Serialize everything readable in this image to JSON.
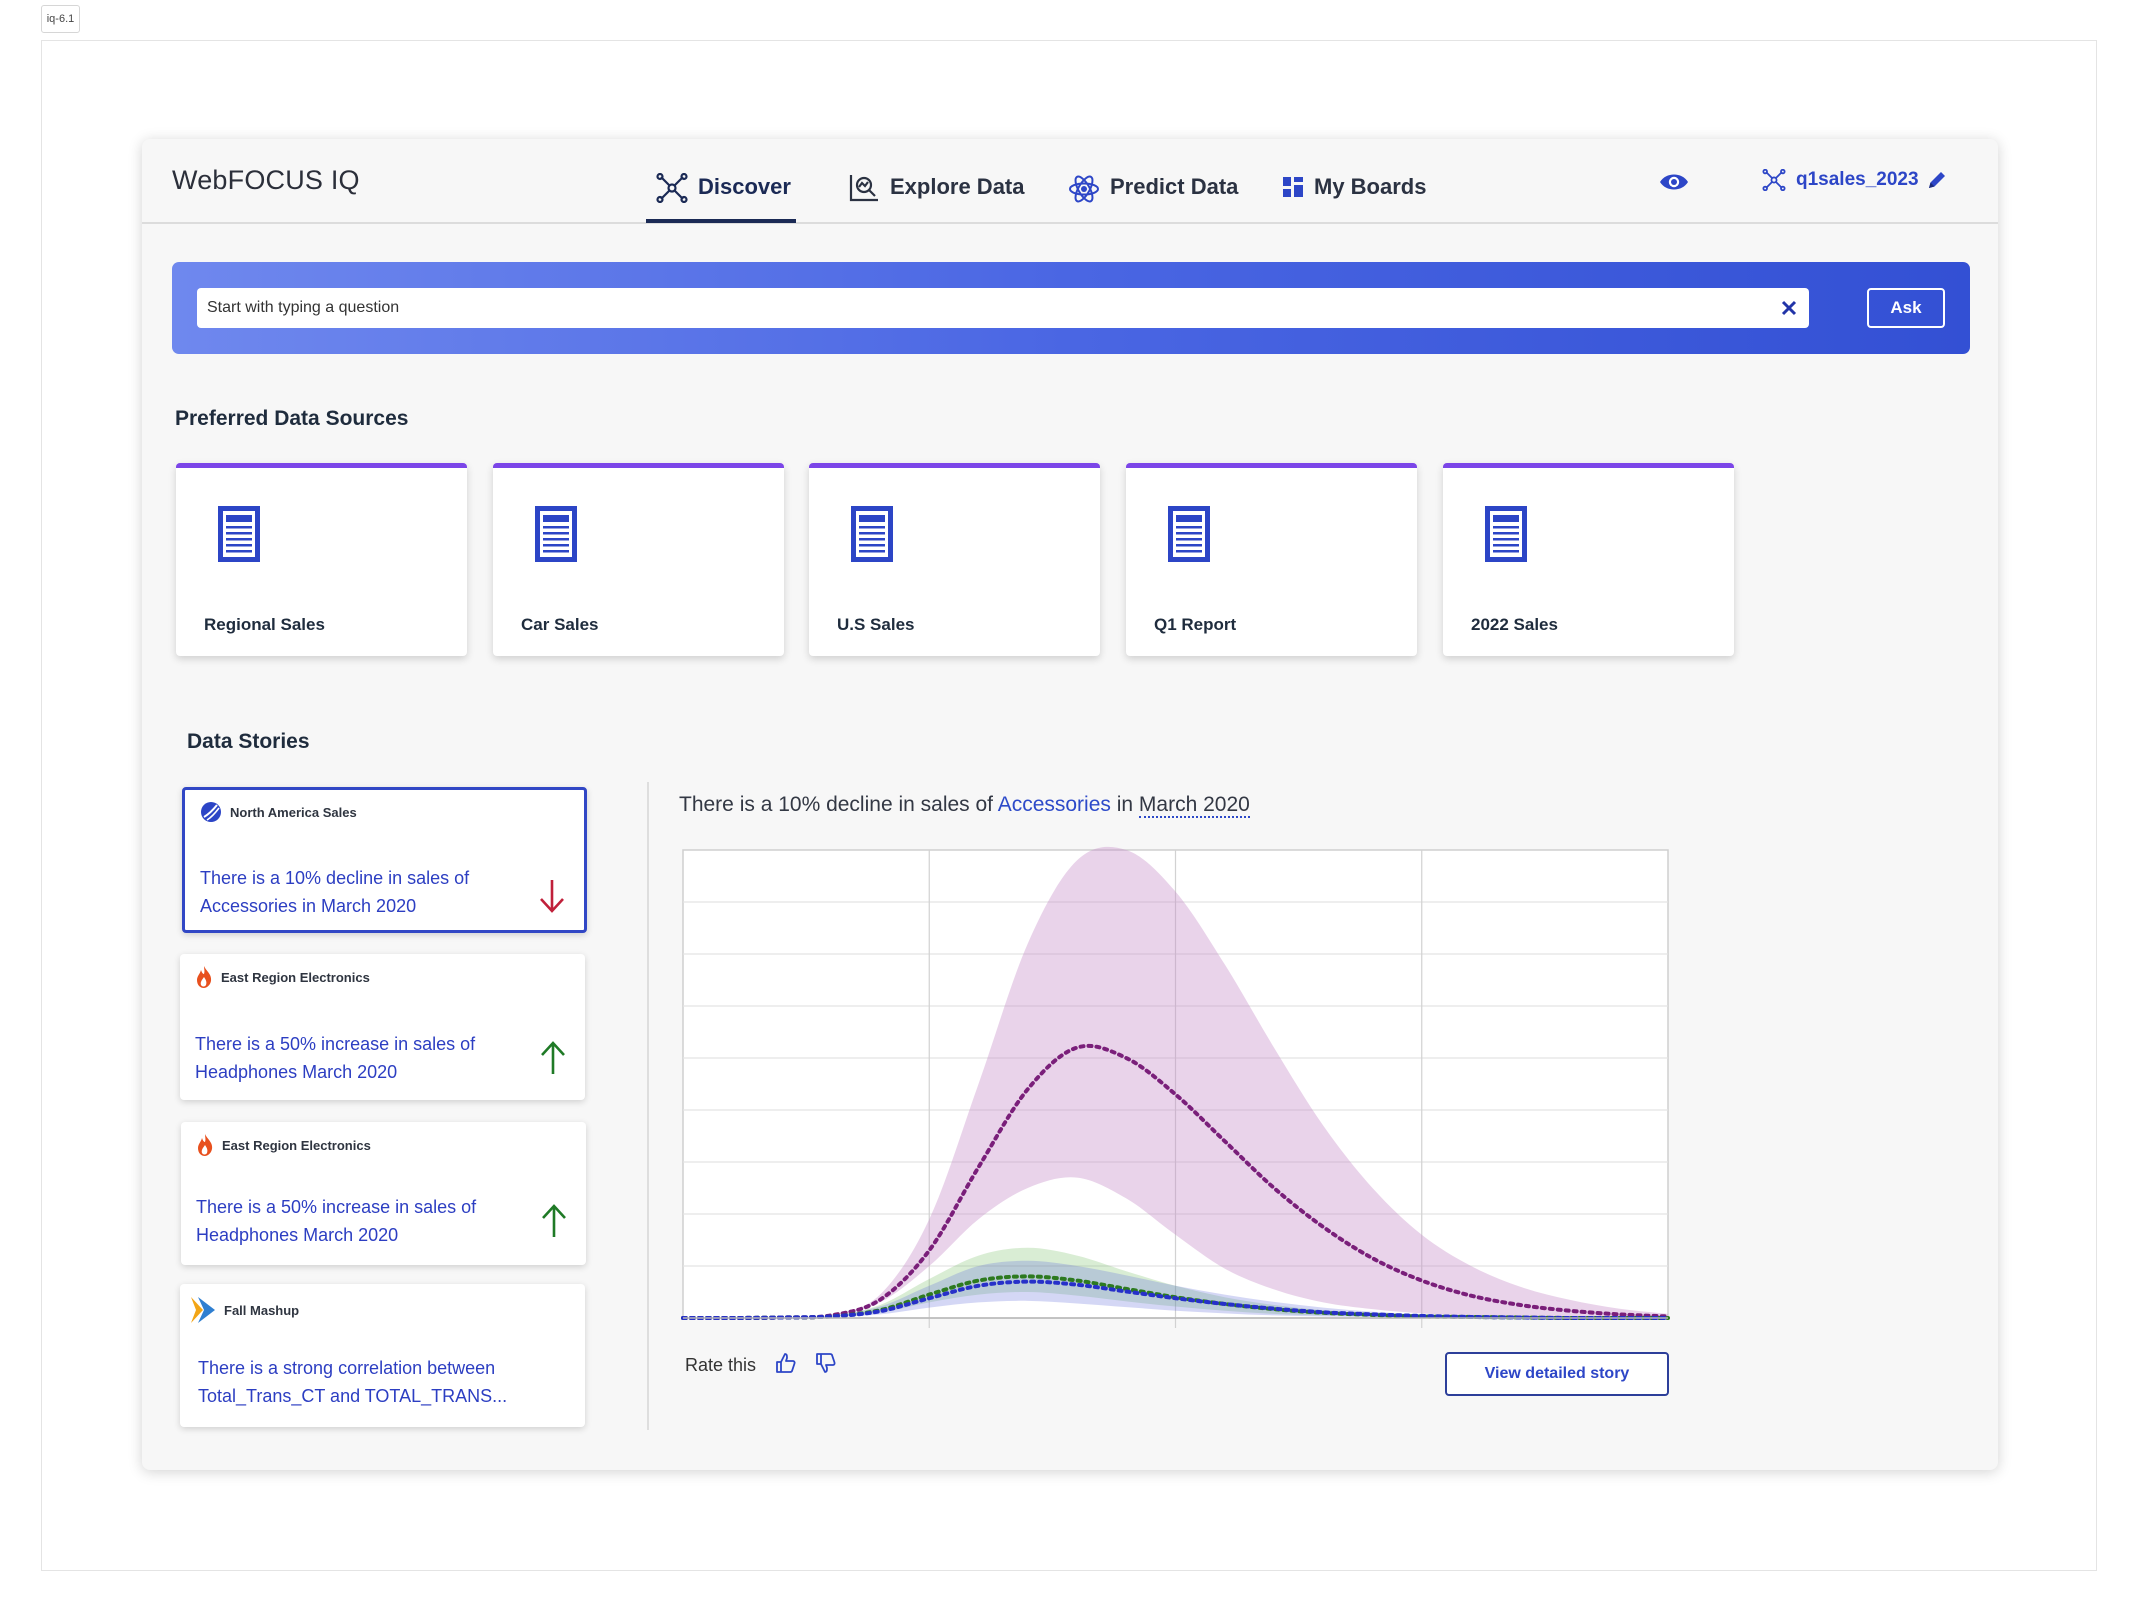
{
  "version_tag": "iq-6.1",
  "app": {
    "brand": "WebFOCUS IQ"
  },
  "nav": {
    "tabs": [
      {
        "label": "Discover",
        "icon": "network-icon",
        "active": true
      },
      {
        "label": "Explore Data",
        "icon": "chart-search-icon",
        "active": false
      },
      {
        "label": "Predict Data",
        "icon": "atom-icon",
        "active": false
      },
      {
        "label": "My Boards",
        "icon": "grid-icon",
        "active": false
      }
    ],
    "dataset": "q1sales_2023"
  },
  "search": {
    "placeholder": "Start with typing a question",
    "value": "",
    "ask_label": "Ask"
  },
  "sources": {
    "title": "Preferred Data Sources",
    "items": [
      "Regional Sales",
      "Car Sales",
      "U.S Sales",
      "Q1 Report",
      "2022 Sales"
    ]
  },
  "stories": {
    "title": "Data Stories",
    "items": [
      {
        "source": "North America Sales",
        "text": "There is a 10% decline in sales of Accessories in March 2020",
        "trend": "down",
        "selected": true
      },
      {
        "source": "East Region Electronics",
        "text": "There is a 50% increase in sales of Headphones March 2020",
        "trend": "up",
        "selected": false
      },
      {
        "source": "East Region Electronics",
        "text": "There is a 50% increase in sales of Headphones March 2020",
        "trend": "up",
        "selected": false
      },
      {
        "source": "Fall Mashup",
        "text": "There is a strong correlation between Total_Trans_CT and TOTAL_TRANS...",
        "trend": "none",
        "selected": false
      }
    ]
  },
  "detail": {
    "title_pre": "There is a 10% decline in sales of ",
    "title_accent": "Accessories",
    "title_mid": " in ",
    "title_post": "March 2020",
    "rate_label": "Rate this",
    "view_button": "View detailed story"
  },
  "colors": {
    "accent": "#2d46c7",
    "purple": "#7b45e8",
    "down": "#c0203a",
    "up": "#1f7a26"
  },
  "chart_data": {
    "type": "area",
    "title": "",
    "xlabel": "",
    "ylabel": "",
    "x": [
      0,
      0.5,
      1,
      1.5,
      2,
      2.5,
      3,
      3.5,
      4,
      4.5,
      5,
      5.5,
      6,
      6.5,
      7,
      7.5,
      8,
      8.5,
      9,
      9.5,
      10
    ],
    "xlim": [
      0,
      10
    ],
    "ylim": [
      0,
      9
    ],
    "grid": true,
    "series": [
      {
        "color": "#7a1f7a",
        "style": "dotted",
        "values": [
          0.0,
          0.0,
          0.01,
          0.05,
          0.35,
          1.3,
          2.9,
          4.4,
          5.2,
          5.0,
          4.3,
          3.4,
          2.5,
          1.75,
          1.15,
          0.72,
          0.43,
          0.25,
          0.14,
          0.07,
          0.03
        ],
        "band_low": [
          0.0,
          0.0,
          0.01,
          0.05,
          0.3,
          1.0,
          1.9,
          2.5,
          2.7,
          2.3,
          1.6,
          0.95,
          0.55,
          0.3,
          0.17,
          0.09,
          0.05,
          0.03,
          0.02,
          0.01,
          0.0
        ],
        "band_high": [
          0.0,
          0.0,
          0.01,
          0.06,
          0.45,
          1.9,
          4.5,
          7.2,
          8.8,
          9.0,
          8.2,
          6.8,
          5.2,
          3.7,
          2.5,
          1.6,
          1.0,
          0.6,
          0.35,
          0.18,
          0.08
        ]
      },
      {
        "color": "#2d7a1f",
        "style": "dotted",
        "values": [
          0.0,
          0.0,
          0.01,
          0.03,
          0.15,
          0.45,
          0.72,
          0.8,
          0.72,
          0.56,
          0.4,
          0.27,
          0.17,
          0.1,
          0.06,
          0.03,
          0.02,
          0.01,
          0.0,
          0.0,
          0.0
        ],
        "band_low": [
          0.0,
          0.0,
          0.01,
          0.02,
          0.1,
          0.3,
          0.45,
          0.5,
          0.43,
          0.32,
          0.22,
          0.14,
          0.08,
          0.05,
          0.03,
          0.01,
          0.01,
          0.0,
          0.0,
          0.0,
          0.0
        ],
        "band_high": [
          0.0,
          0.0,
          0.01,
          0.04,
          0.25,
          0.75,
          1.2,
          1.35,
          1.2,
          0.9,
          0.62,
          0.4,
          0.25,
          0.15,
          0.08,
          0.04,
          0.02,
          0.01,
          0.0,
          0.0,
          0.0
        ]
      },
      {
        "color": "#2730c9",
        "style": "dotted",
        "values": [
          0.0,
          0.0,
          0.01,
          0.03,
          0.13,
          0.38,
          0.62,
          0.7,
          0.64,
          0.51,
          0.38,
          0.27,
          0.18,
          0.11,
          0.07,
          0.04,
          0.02,
          0.01,
          0.0,
          0.0,
          0.0
        ],
        "band_low": [
          0.0,
          0.0,
          0.0,
          0.02,
          0.07,
          0.2,
          0.3,
          0.33,
          0.28,
          0.21,
          0.14,
          0.09,
          0.05,
          0.03,
          0.02,
          0.01,
          0.0,
          0.0,
          0.0,
          0.0,
          0.0
        ],
        "band_high": [
          0.0,
          0.0,
          0.01,
          0.05,
          0.22,
          0.62,
          1.0,
          1.1,
          1.0,
          0.82,
          0.62,
          0.45,
          0.31,
          0.2,
          0.12,
          0.07,
          0.04,
          0.02,
          0.01,
          0.0,
          0.0
        ]
      }
    ]
  }
}
